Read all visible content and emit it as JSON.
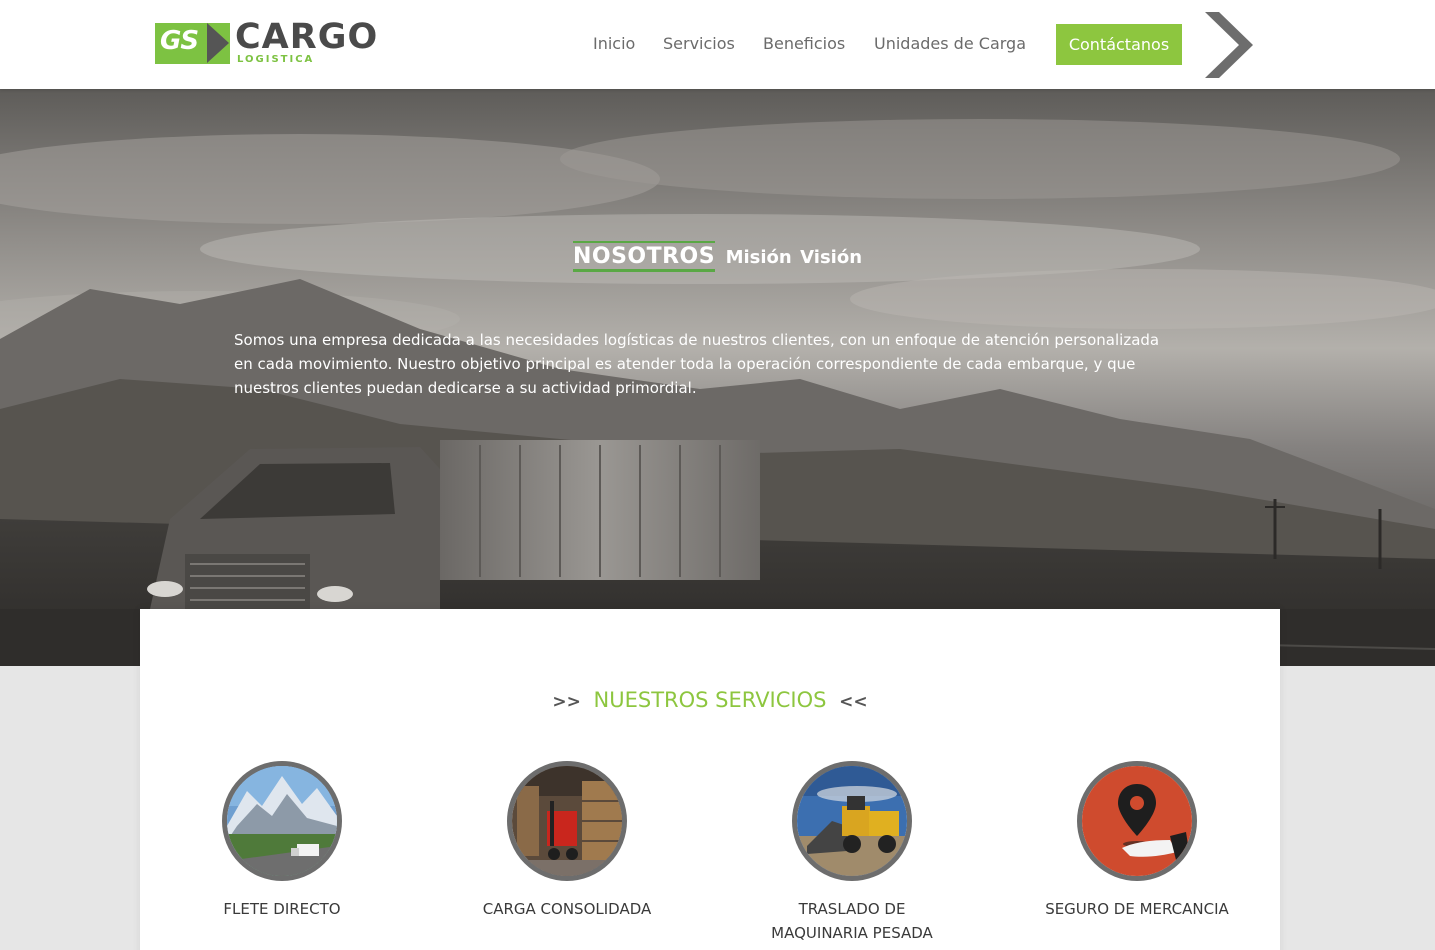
{
  "brand": {
    "logo_mark": "GS",
    "logo_word": "CARGO",
    "logo_sub": "LOGISTICA",
    "accent_color": "#8dc63f",
    "dark_color": "#4a4a4a"
  },
  "nav": {
    "items": [
      "Inicio",
      "Servicios",
      "Beneficios",
      "Unidades de Carga"
    ],
    "cta": "Contáctanos",
    "next_icon": "chevron-right-icon"
  },
  "hero": {
    "tabs": [
      "NOSOTROS",
      "Misión",
      "Visión"
    ],
    "active_tab": "NOSOTROS",
    "text": "Somos una empresa dedicada a las necesidades logísticas de nuestros clientes, con un enfoque de atención personalizada en cada movimiento. Nuestro objetivo principal es atender toda la operación correspondiente de cada embarque, y que nuestros clientes puedan dedicarse a su actividad primordial."
  },
  "services": {
    "title_left": ">>",
    "title": "NUESTROS SERVICIOS",
    "title_right": "<<",
    "items": [
      {
        "label": "FLETE DIRECTO",
        "image": "mountain-highway-truck"
      },
      {
        "label": "CARGA CONSOLIDADA",
        "image": "warehouse-forklift"
      },
      {
        "label": "TRASLADO DE MAQUINARIA PESADA",
        "image": "heavy-machinery"
      },
      {
        "label": "SEGURO DE MERCANCIA",
        "image": "hand-location-pin"
      }
    ]
  }
}
